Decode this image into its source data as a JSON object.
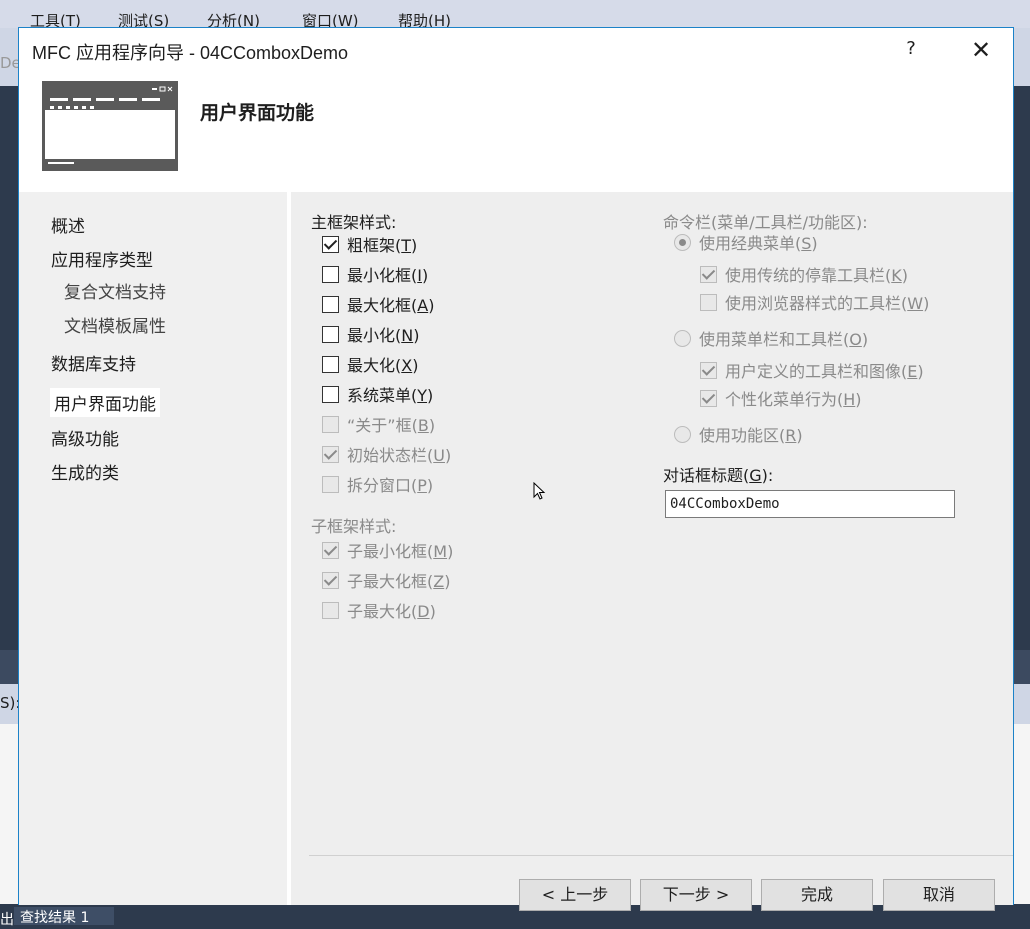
{
  "ide": {
    "menus": [
      "工具(T)",
      "测试(S)",
      "分析(N)",
      "窗口(W)",
      "帮助(H)"
    ],
    "left_field_fragment": "De",
    "panel_label": "S):",
    "bottom_prefix": "出",
    "bottom_tab": "查找结果 1"
  },
  "dialog": {
    "title": "MFC 应用程序向导 - 04CComboxDemo",
    "help_label": "?",
    "close_label": "✕",
    "header_title": "用户界面功能"
  },
  "nav": {
    "items": [
      {
        "label": "概述"
      },
      {
        "label": "应用程序类型"
      },
      {
        "label": "复合文档支持"
      },
      {
        "label": "文档模板属性"
      },
      {
        "label": "数据库支持"
      },
      {
        "label": "用户界面功能"
      },
      {
        "label": "高级功能"
      },
      {
        "label": "生成的类"
      }
    ]
  },
  "main_frame": {
    "label": "主框架样式:",
    "options": [
      {
        "text": "粗框架(",
        "key": "T",
        "checked": true,
        "enabled": true
      },
      {
        "text": "最小化框(",
        "key": "I",
        "checked": false,
        "enabled": true
      },
      {
        "text": "最大化框(",
        "key": "A",
        "checked": false,
        "enabled": true
      },
      {
        "text": "最小化(",
        "key": "N",
        "checked": false,
        "enabled": true
      },
      {
        "text": "最大化(",
        "key": "X",
        "checked": false,
        "enabled": true
      },
      {
        "text": "系统菜单(",
        "key": "Y",
        "checked": false,
        "enabled": true
      },
      {
        "text": "“关于”框(",
        "key": "B",
        "checked": false,
        "enabled": false
      },
      {
        "text": "初始状态栏(",
        "key": "U",
        "checked": true,
        "enabled": false
      },
      {
        "text": "拆分窗口(",
        "key": "P",
        "checked": false,
        "enabled": false
      }
    ]
  },
  "child_frame": {
    "label": "子框架样式:",
    "options": [
      {
        "text": "子最小化框(",
        "key": "M",
        "checked": true
      },
      {
        "text": "子最大化框(",
        "key": "Z",
        "checked": true
      },
      {
        "text": "子最大化(",
        "key": "D",
        "checked": false
      }
    ]
  },
  "command_bar": {
    "label": "命令栏(菜单/工具栏/功能区):",
    "classic_menu": {
      "text": "使用经典菜单(",
      "key": "S",
      "selected": true
    },
    "classic_sub": [
      {
        "text": "使用传统的停靠工具栏(",
        "key": "K",
        "checked": true
      },
      {
        "text": "使用浏览器样式的工具栏(",
        "key": "W",
        "checked": false
      }
    ],
    "menubar": {
      "text": "使用菜单栏和工具栏(",
      "key": "O",
      "selected": false
    },
    "menubar_sub": [
      {
        "text": "用户定义的工具栏和图像(",
        "key": "E",
        "checked": true
      },
      {
        "text": "个性化菜单行为(",
        "key": "H",
        "checked": true
      }
    ],
    "ribbon": {
      "text": "使用功能区(",
      "key": "R",
      "selected": false
    }
  },
  "dialog_title_field": {
    "label_text": "对话框标题(",
    "label_key": "G",
    "label_tail": "):",
    "value": "04CComboxDemo"
  },
  "buttons": {
    "back": "< 上一步",
    "next": "下一步 >",
    "finish": "完成",
    "cancel": "取消"
  }
}
